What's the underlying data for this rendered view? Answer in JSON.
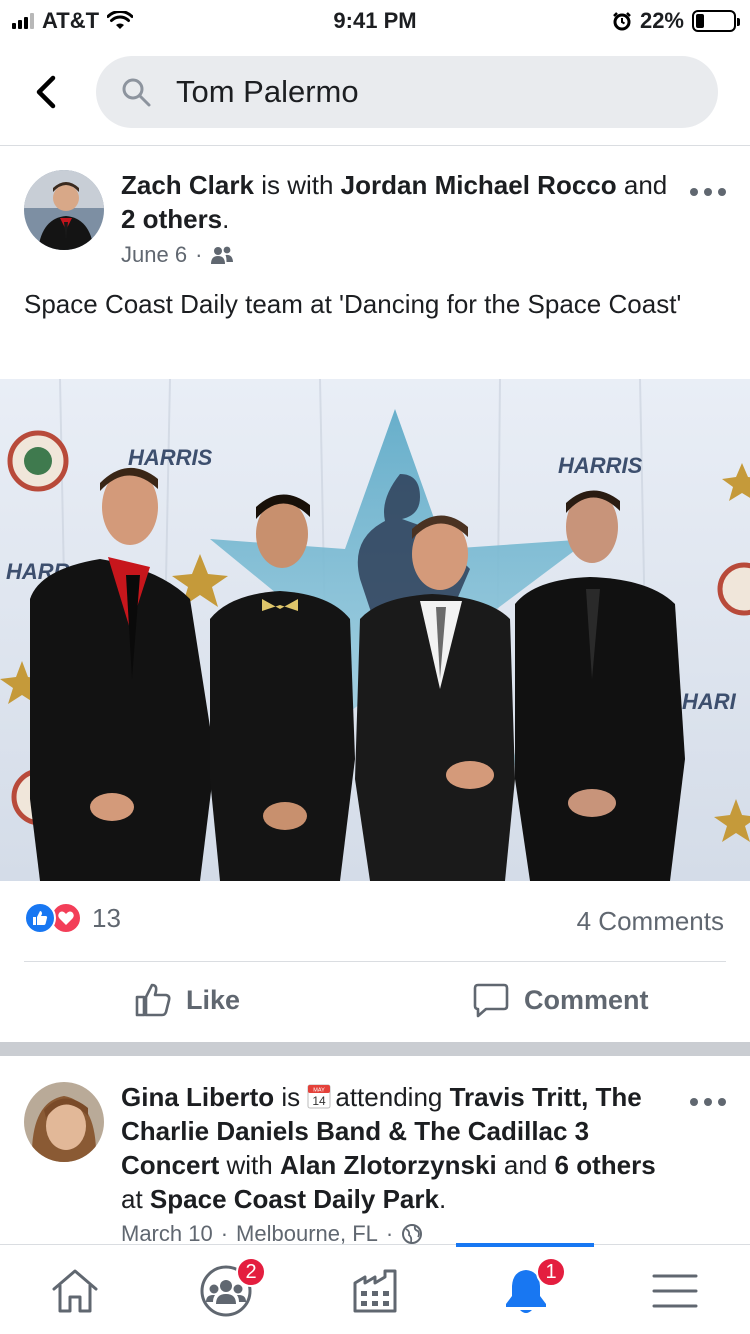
{
  "status_bar": {
    "carrier": "AT&T",
    "time": "9:41 PM",
    "battery_text": "22%",
    "battery_level": 0.22
  },
  "search": {
    "query": "Tom Palermo"
  },
  "post1": {
    "author": "Zach Clark",
    "with_word": "is with",
    "tagged": "Jordan Michael Rocco",
    "and_word": "and",
    "others": "2 others",
    "period": ".",
    "date": "June 6",
    "dot": "·",
    "privacy_icon": "friends-icon",
    "text": "Space Coast Daily team at 'Dancing for the Space Coast'",
    "photo_banner": {
      "sponsor_left": "HARRIS",
      "sponsor_right": "HARRIS",
      "sponsor_edge_left": "HARR",
      "sponsor_edge_right": "HARI"
    },
    "reaction_count": "13",
    "comments": "4 Comments",
    "like_label": "Like",
    "comment_label": "Comment"
  },
  "post2": {
    "author": "Gina Liberto",
    "is_word": "is",
    "calendar_month": "MAY",
    "calendar_day": "14",
    "attending_word": "attending",
    "event": "Travis Tritt, The Charlie Daniels Band & The Cadillac 3 Concert",
    "with_word": "with",
    "tagged": "Alan Zlotorzynski",
    "and_word": "and",
    "others": "6 others",
    "at_word": "at",
    "place": "Space Coast Daily Park",
    "period": ".",
    "date": "March 10",
    "location": "Melbourne, FL",
    "dot": "·"
  },
  "bottom_nav": {
    "groups_badge": "2",
    "notifications_badge": "1"
  },
  "colors": {
    "facebook_blue": "#1877f2",
    "badge_red": "#e41e3f",
    "secondary_text": "#606770"
  }
}
